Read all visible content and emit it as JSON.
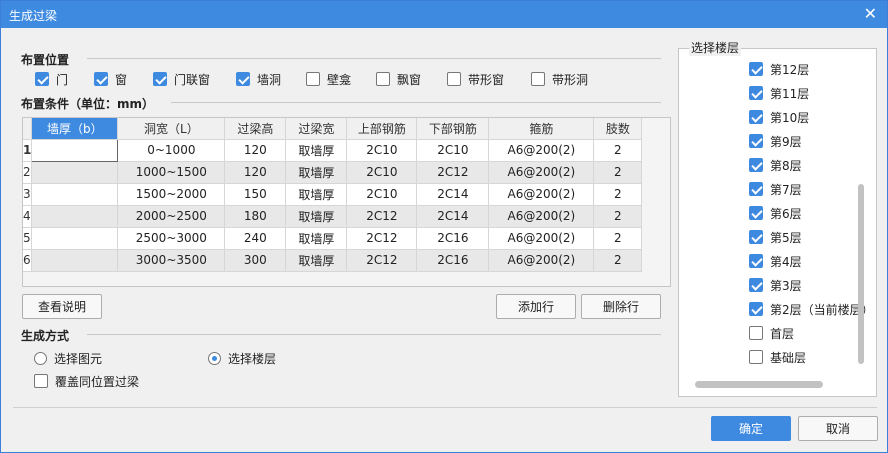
{
  "window": {
    "title": "生成过梁",
    "close_glyph": "✕"
  },
  "placement": {
    "label": "布置位置",
    "options": [
      {
        "label": "门",
        "checked": true
      },
      {
        "label": "窗",
        "checked": true
      },
      {
        "label": "门联窗",
        "checked": true
      },
      {
        "label": "墙洞",
        "checked": true
      },
      {
        "label": "壁龛",
        "checked": false
      },
      {
        "label": "飘窗",
        "checked": false
      },
      {
        "label": "带形窗",
        "checked": false
      },
      {
        "label": "带形洞",
        "checked": false
      }
    ]
  },
  "conditions": {
    "label": "布置条件（单位：mm）",
    "columns": [
      "墙厚（b）",
      "洞宽（L）",
      "过梁高",
      "过梁宽",
      "上部钢筋",
      "下部钢筋",
      "箍筋",
      "肢数"
    ],
    "rows": [
      {
        "n": "1",
        "wall": "",
        "width": "0~1000",
        "height": "120",
        "bwidth": "取墙厚",
        "top": "2C10",
        "bottom": "2C10",
        "stirrup": "A6@200(2)",
        "legs": "2"
      },
      {
        "n": "2",
        "wall": "",
        "width": "1000~1500",
        "height": "120",
        "bwidth": "取墙厚",
        "top": "2C10",
        "bottom": "2C12",
        "stirrup": "A6@200(2)",
        "legs": "2"
      },
      {
        "n": "3",
        "wall": "",
        "width": "1500~2000",
        "height": "150",
        "bwidth": "取墙厚",
        "top": "2C10",
        "bottom": "2C14",
        "stirrup": "A6@200(2)",
        "legs": "2"
      },
      {
        "n": "4",
        "wall": "",
        "width": "2000~2500",
        "height": "180",
        "bwidth": "取墙厚",
        "top": "2C12",
        "bottom": "2C14",
        "stirrup": "A6@200(2)",
        "legs": "2"
      },
      {
        "n": "5",
        "wall": "",
        "width": "2500~3000",
        "height": "240",
        "bwidth": "取墙厚",
        "top": "2C12",
        "bottom": "2C16",
        "stirrup": "A6@200(2)",
        "legs": "2"
      },
      {
        "n": "6",
        "wall": "",
        "width": "3000~3500",
        "height": "300",
        "bwidth": "取墙厚",
        "top": "2C12",
        "bottom": "2C16",
        "stirrup": "A6@200(2)",
        "legs": "2"
      }
    ]
  },
  "buttons": {
    "view_help": "查看说明",
    "add_row": "添加行",
    "delete_row": "删除行",
    "ok": "确定",
    "cancel": "取消"
  },
  "generate": {
    "label": "生成方式",
    "radio_select_element": "选择图元",
    "radio_select_floor": "选择楼层",
    "selected": "选择楼层",
    "overwrite_label": "覆盖同位置过梁",
    "overwrite_checked": false
  },
  "floors": {
    "label": "选择楼层",
    "items": [
      {
        "label": "第12层",
        "checked": true
      },
      {
        "label": "第11层",
        "checked": true
      },
      {
        "label": "第10层",
        "checked": true
      },
      {
        "label": "第9层",
        "checked": true
      },
      {
        "label": "第8层",
        "checked": true
      },
      {
        "label": "第7层",
        "checked": true
      },
      {
        "label": "第6层",
        "checked": true
      },
      {
        "label": "第5层",
        "checked": true
      },
      {
        "label": "第4层",
        "checked": true
      },
      {
        "label": "第3层",
        "checked": true
      },
      {
        "label": "第2层（当前楼层）",
        "checked": true
      },
      {
        "label": "首层",
        "checked": false
      },
      {
        "label": "基础层",
        "checked": false
      }
    ]
  },
  "colors": {
    "accent": "#3e8ae0"
  }
}
